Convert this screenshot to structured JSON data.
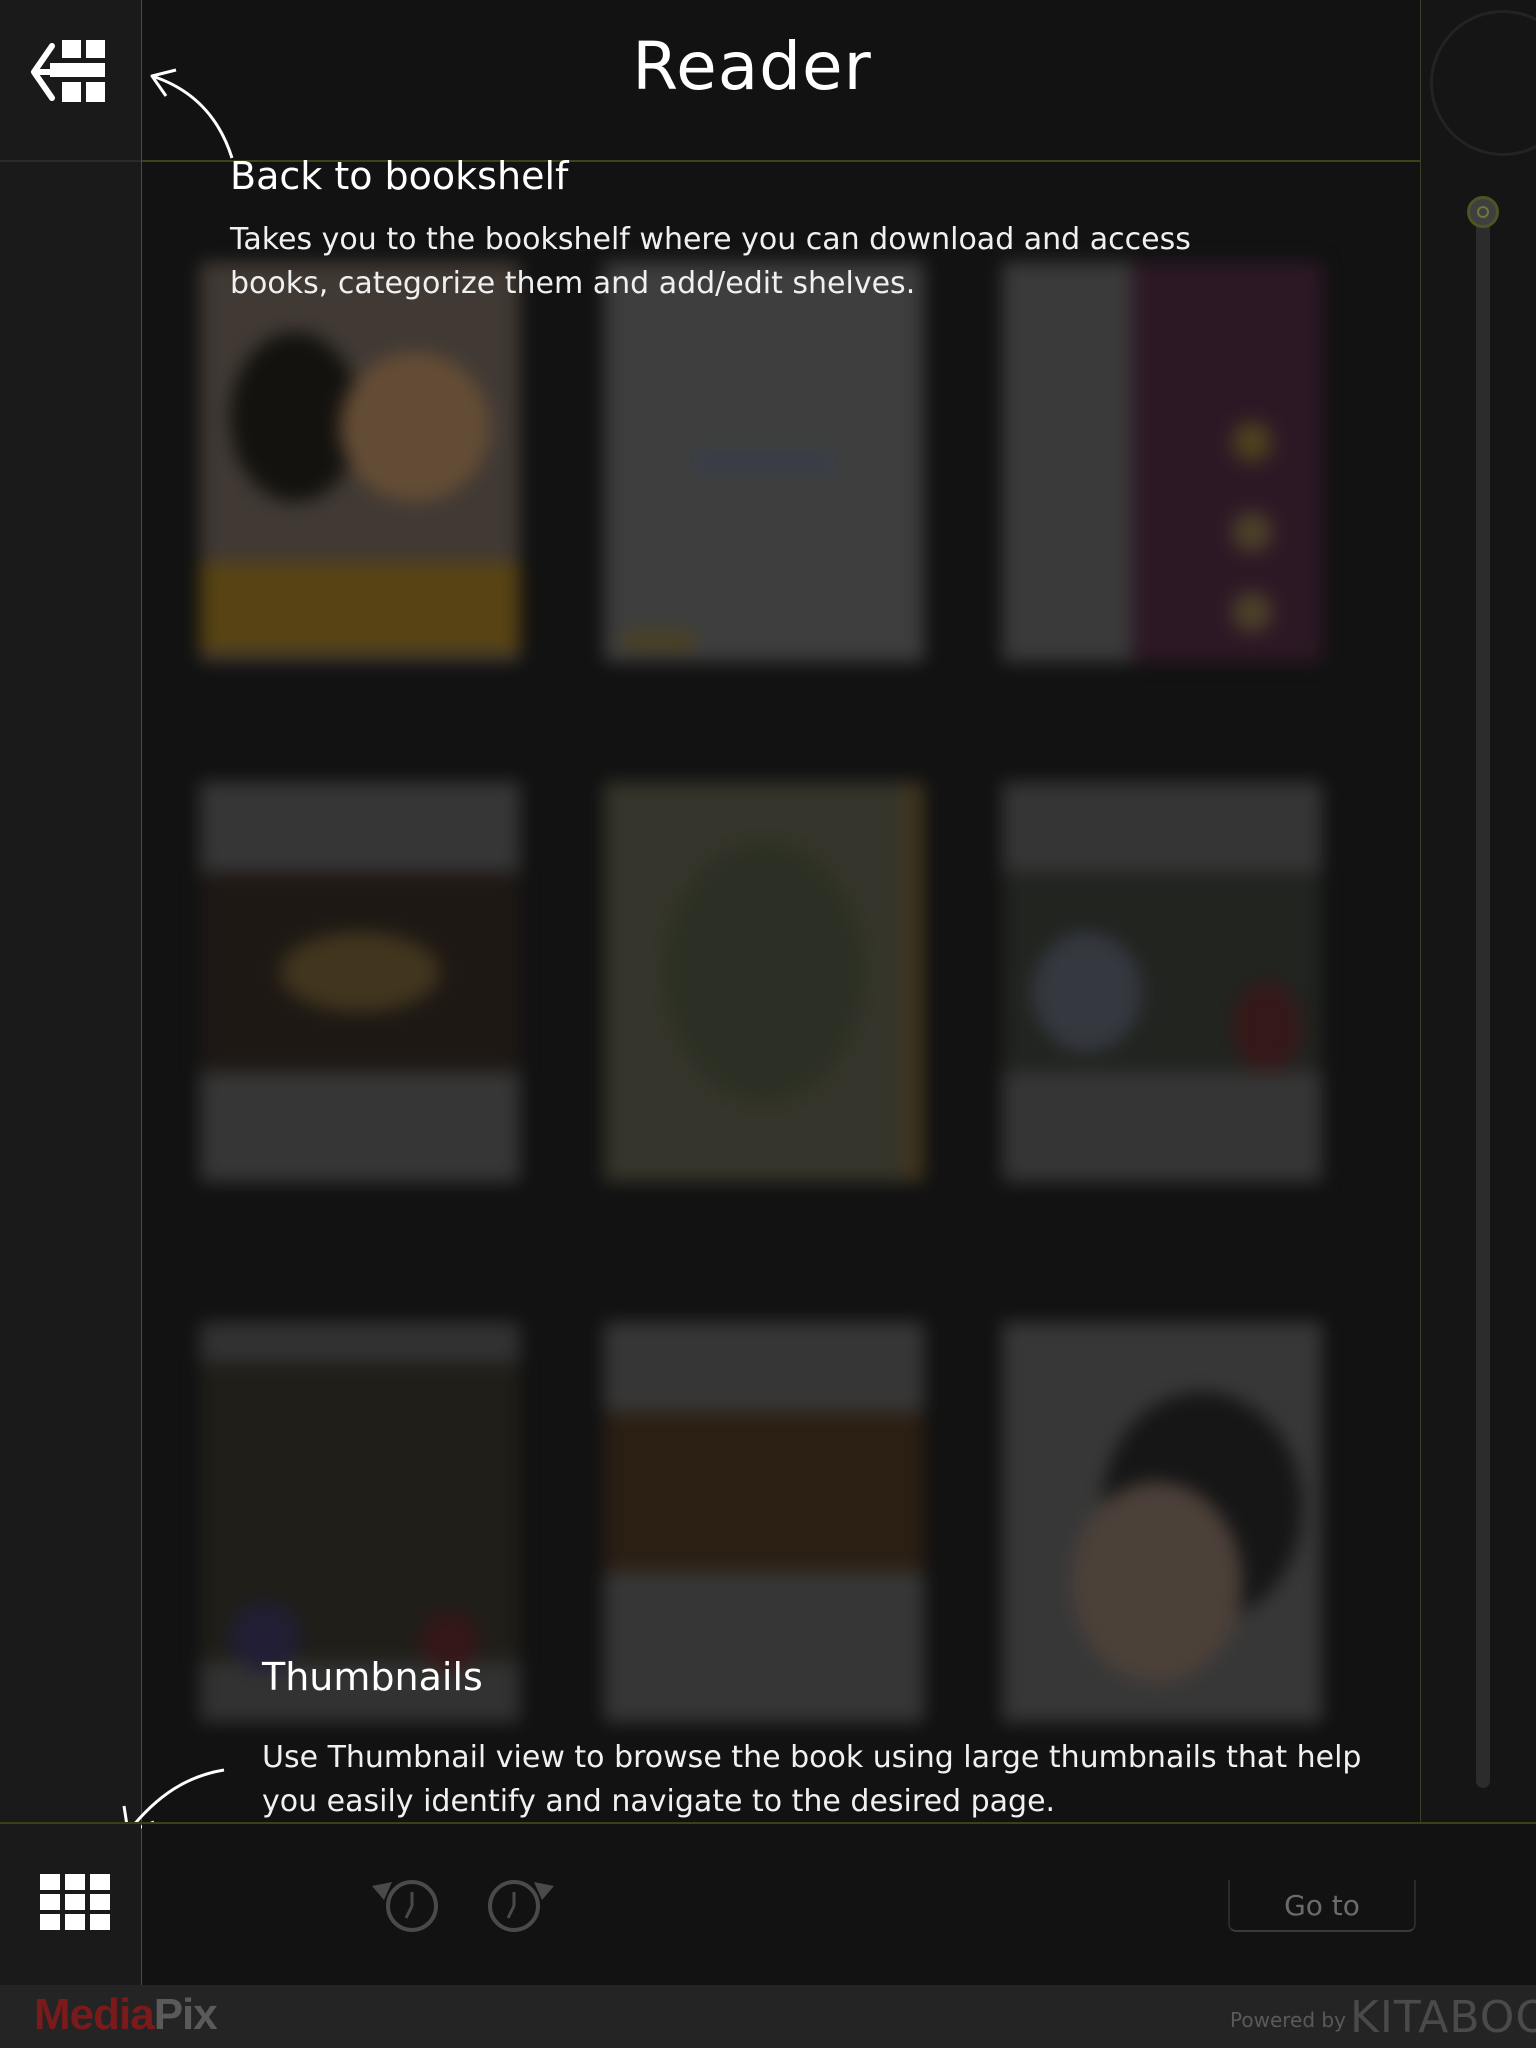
{
  "header": {
    "title": "Reader"
  },
  "callouts": {
    "back": {
      "title": "Back to bookshelf",
      "body": "Takes you to the bookshelf where you can download and access books, categorize them and add/edit shelves."
    },
    "thumbnails": {
      "title": "Thumbnails",
      "body": "Use Thumbnail view to browse the book using large thumbnails that help you easily identify and navigate to the desired page."
    }
  },
  "toolbar": {
    "goto_label": "Go to"
  },
  "footer": {
    "brand_part1": "Media",
    "brand_part2": "Pix",
    "powered_by": "Powered by",
    "kitaboo": "KITABOO"
  },
  "icons": {
    "back": "back-to-bookshelf-icon",
    "thumbnails": "thumbnails-grid-icon",
    "history_back": "history-back-icon",
    "history_forward": "history-forward-icon"
  },
  "colors": {
    "accent_line": "#3e4219",
    "brand_red": "#7a1a1a",
    "background": "#111111"
  }
}
